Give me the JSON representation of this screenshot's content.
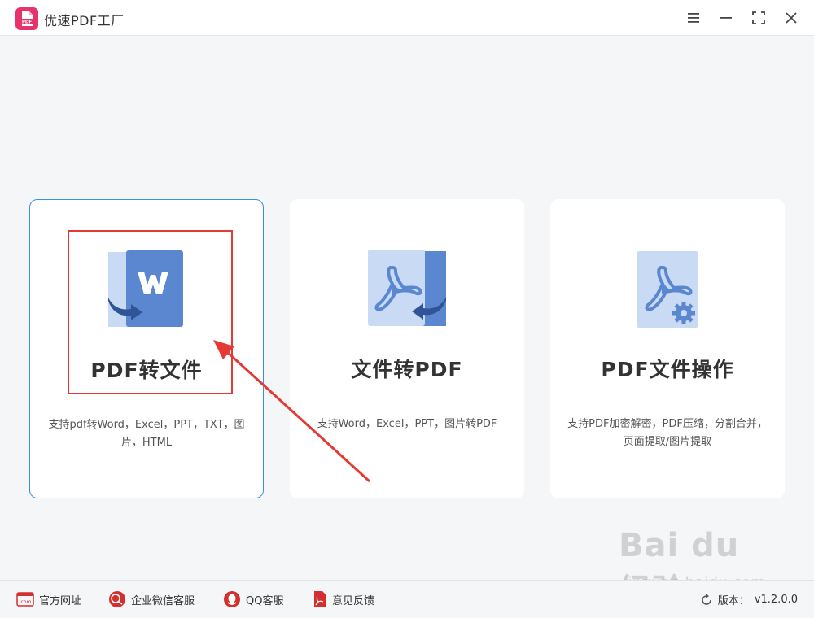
{
  "app": {
    "title": "优速PDF工厂",
    "logo_icon": "pdf-logo-icon",
    "logo_text": "PDF"
  },
  "window_controls": [
    "menu-icon",
    "minimize-icon",
    "maximize-icon",
    "close-icon"
  ],
  "cards": [
    {
      "title": "PDF转文件",
      "description": "支持pdf转Word，Excel，PPT，TXT，图片，HTML",
      "icon": "pdf-to-word-icon",
      "selected": true
    },
    {
      "title": "文件转PDF",
      "description": "支持Word，Excel，PPT，图片转PDF",
      "icon": "file-to-pdf-icon",
      "selected": false
    },
    {
      "title": "PDF文件操作",
      "description": "支持PDF加密解密，PDF压缩，分割合并，页面提取/图片提取",
      "icon": "pdf-operation-icon",
      "selected": false
    }
  ],
  "footer": {
    "links": [
      {
        "label": "官方网址",
        "icon": "website-icon",
        "icon_text": ".com"
      },
      {
        "label": "企业微信客服",
        "icon": "wechat-work-icon"
      },
      {
        "label": "QQ客服",
        "icon": "qq-icon"
      },
      {
        "label": "意见反馈",
        "icon": "feedback-icon"
      }
    ],
    "version_label": "版本：",
    "version_value": "v1.2.0.0"
  },
  "watermark": {
    "text": "Bai du 经验",
    "url": "jingyan.baidu.com"
  },
  "colors": {
    "accent_red": "#e53935",
    "selected_border": "#3c8ee0",
    "icon_blue": "#5a87cf",
    "icon_light": "#c9daf4",
    "logo_pink": "#e6336b"
  }
}
